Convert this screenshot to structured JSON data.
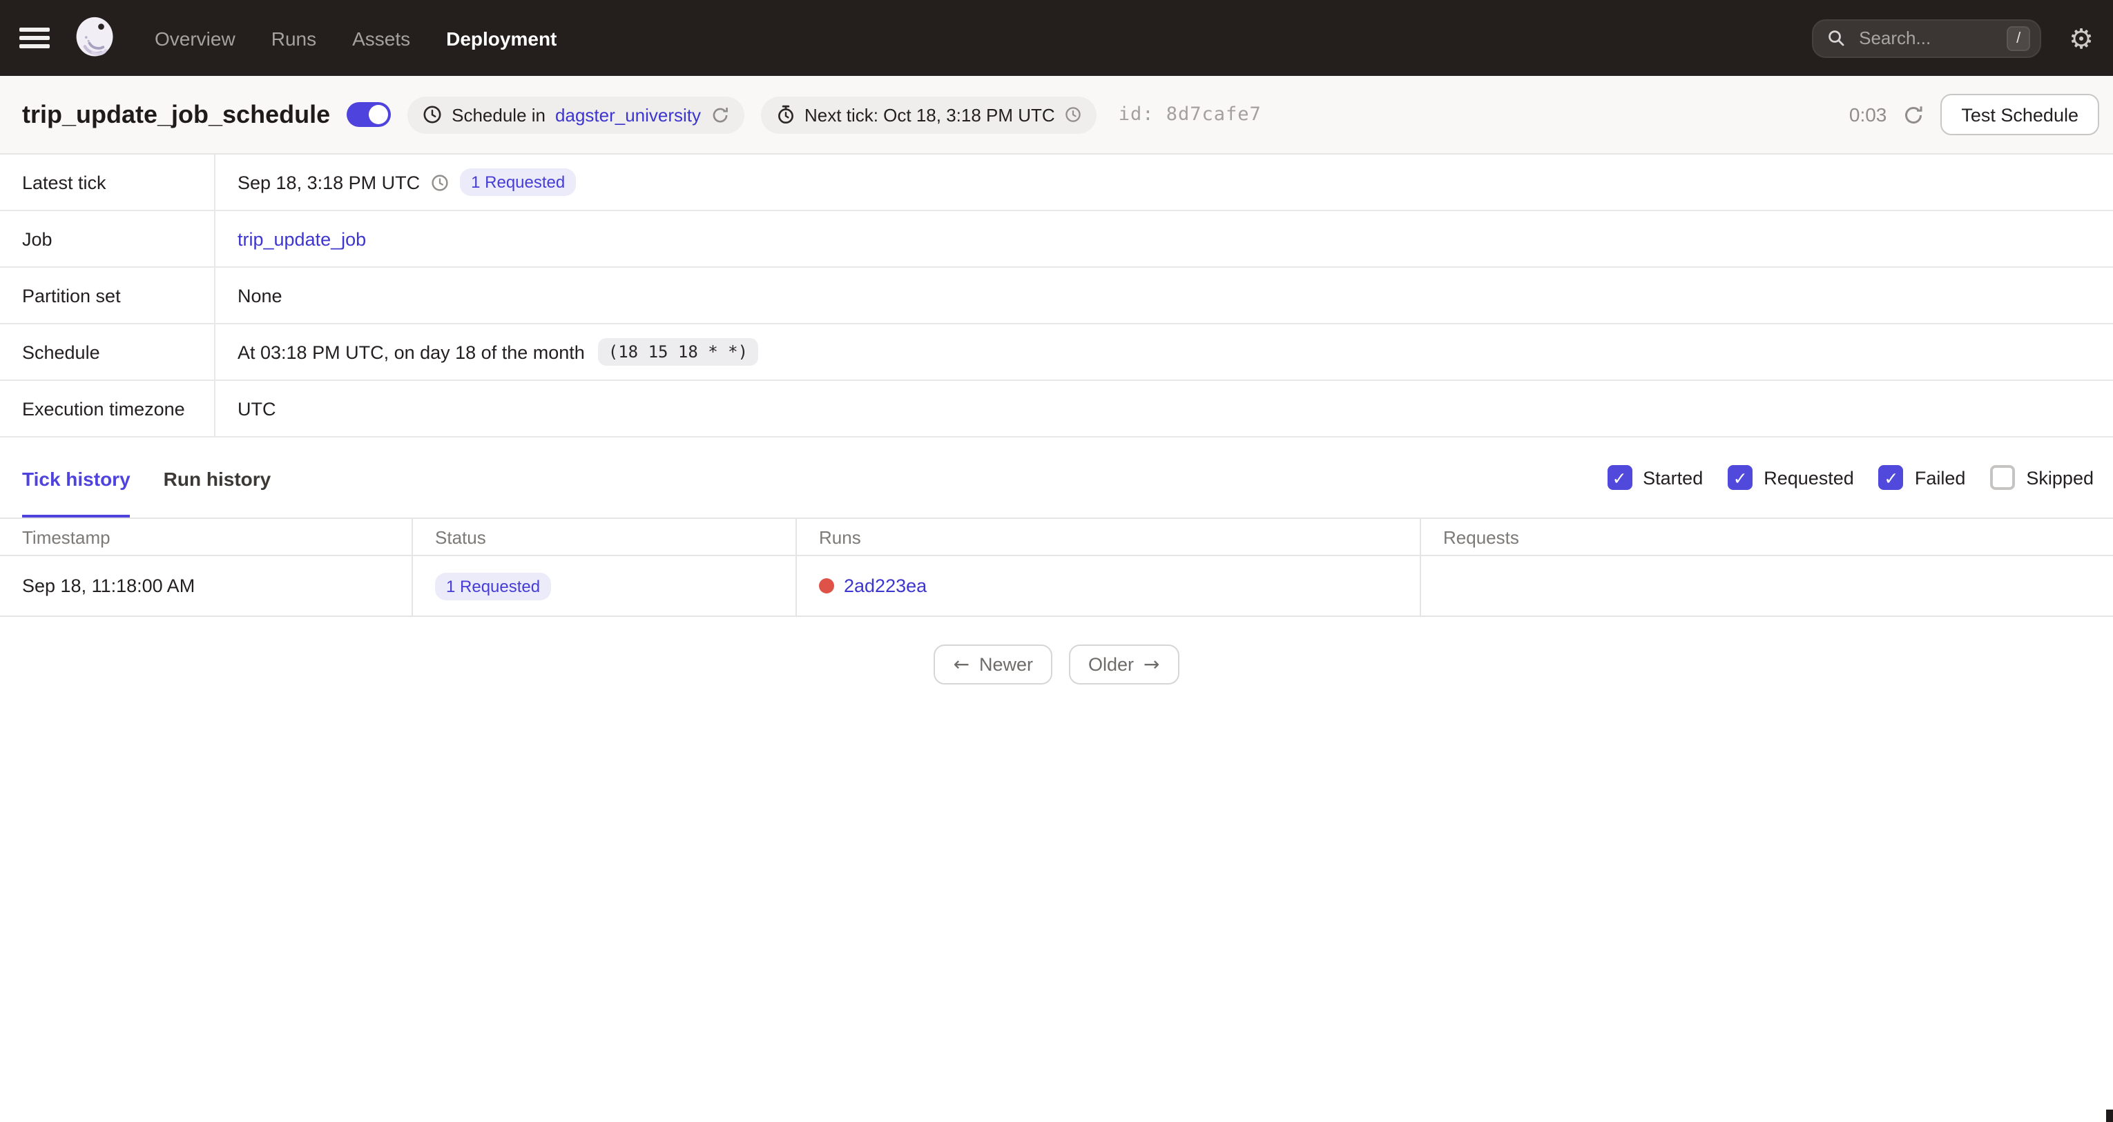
{
  "colors": {
    "accent": "#4F43DD",
    "link": "#3D35D0",
    "failed_run_dot": "#DE5248",
    "nav_background": "#241F1D",
    "title_background": "#F9F8F6"
  },
  "nav": {
    "items": [
      {
        "label": "Overview",
        "active": false
      },
      {
        "label": "Runs",
        "active": false
      },
      {
        "label": "Assets",
        "active": false
      },
      {
        "label": "Deployment",
        "active": true
      }
    ],
    "search": {
      "placeholder": "Search...",
      "shortcut": "/"
    }
  },
  "header": {
    "title": "trip_update_job_schedule",
    "toggle_on": true,
    "schedule_tag": {
      "text": "Schedule in",
      "link": "dagster_university"
    },
    "next_tick_tag": {
      "text": "Next tick: Oct 18, 3:18 PM UTC"
    },
    "id_text": "id: 8d7cafe7",
    "timer": "0:03",
    "test_button": "Test Schedule"
  },
  "details": {
    "rows": [
      {
        "label": "Latest tick",
        "value": "Sep 18, 3:18 PM UTC",
        "badge": "1 Requested"
      },
      {
        "label": "Job",
        "link": "trip_update_job"
      },
      {
        "label": "Partition set",
        "value": "None"
      },
      {
        "label": "Schedule",
        "value": "At 03:18 PM UTC, on day 18 of the month",
        "cron": "(18 15 18 * *)"
      },
      {
        "label": "Execution timezone",
        "value": "UTC"
      }
    ]
  },
  "tabs": [
    {
      "label": "Tick history",
      "active": true
    },
    {
      "label": "Run history",
      "active": false
    }
  ],
  "filters": [
    {
      "label": "Started",
      "checked": true
    },
    {
      "label": "Requested",
      "checked": true
    },
    {
      "label": "Failed",
      "checked": true
    },
    {
      "label": "Skipped",
      "checked": false
    }
  ],
  "tick_table": {
    "columns": [
      "Timestamp",
      "Status",
      "Runs",
      "Requests"
    ],
    "rows": [
      {
        "timestamp": "Sep 18, 11:18:00 AM",
        "status_badge": "1 Requested",
        "run_id": "2ad223ea",
        "requests": ""
      }
    ]
  },
  "pagination": {
    "newer": "Newer",
    "older": "Older"
  },
  "icons": {
    "arrow_left": "←",
    "arrow_right": "→",
    "check": "✓",
    "gear": "⚙"
  }
}
